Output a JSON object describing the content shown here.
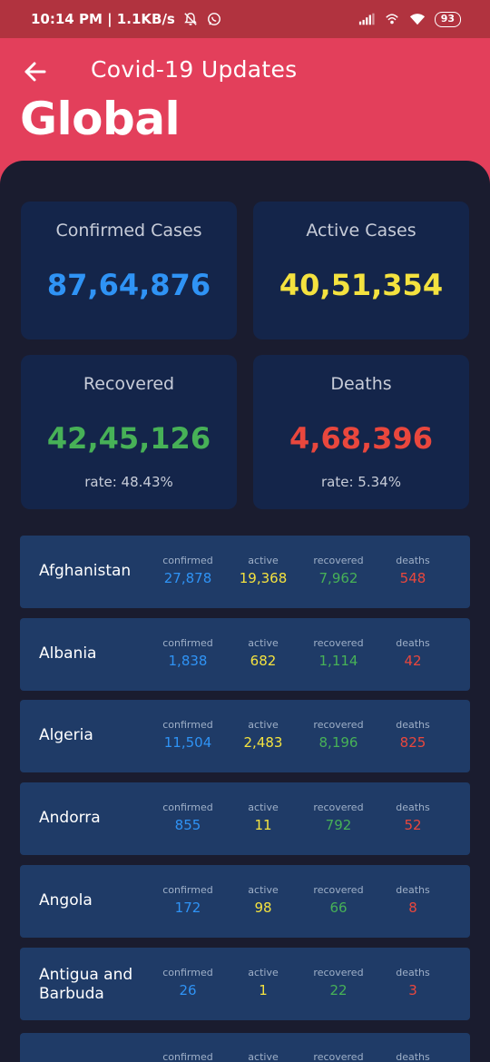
{
  "status_bar": {
    "time_speed": "10:14 PM | 1.1KB/s",
    "battery": "93"
  },
  "header": {
    "title": "Covid-19 Updates",
    "page_title": "Global"
  },
  "stats": {
    "confirmed": {
      "label": "Confirmed Cases",
      "value": "87,64,876"
    },
    "active": {
      "label": "Active Cases",
      "value": "40,51,354"
    },
    "recovered": {
      "label": "Recovered",
      "value": "42,45,126",
      "rate": "rate: 48.43%"
    },
    "deaths": {
      "label": "Deaths",
      "value": "4,68,396",
      "rate": "rate: 5.34%"
    }
  },
  "column_labels": {
    "confirmed": "confirmed",
    "active": "active",
    "recovered": "recovered",
    "deaths": "deaths"
  },
  "countries": [
    {
      "name": "Afghanistan",
      "confirmed": "27,878",
      "active": "19,368",
      "recovered": "7,962",
      "deaths": "548"
    },
    {
      "name": "Albania",
      "confirmed": "1,838",
      "active": "682",
      "recovered": "1,114",
      "deaths": "42"
    },
    {
      "name": "Algeria",
      "confirmed": "11,504",
      "active": "2,483",
      "recovered": "8,196",
      "deaths": "825"
    },
    {
      "name": "Andorra",
      "confirmed": "855",
      "active": "11",
      "recovered": "792",
      "deaths": "52"
    },
    {
      "name": "Angola",
      "confirmed": "172",
      "active": "98",
      "recovered": "66",
      "deaths": "8"
    },
    {
      "name": "Antigua and Barbuda",
      "confirmed": "26",
      "active": "1",
      "recovered": "22",
      "deaths": "3"
    },
    {
      "name": "",
      "confirmed": "",
      "active": "",
      "recovered": "",
      "deaths": ""
    }
  ],
  "colors": {
    "header_bg": "#e33f5b",
    "panel_bg": "#1a1c2f",
    "card_bg": "#14254a",
    "row_bg": "#1f3b67",
    "confirmed": "#2f93f5",
    "active": "#f4e23f",
    "recovered": "#47b157",
    "deaths": "#e9473d"
  }
}
